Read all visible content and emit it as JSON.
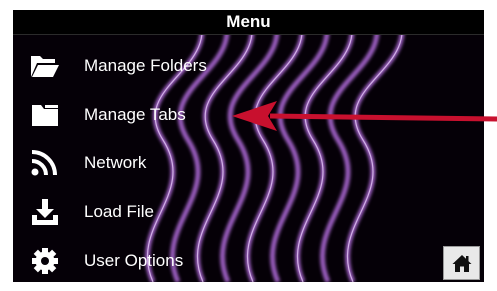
{
  "header": {
    "title": "Menu"
  },
  "menu": {
    "items": [
      {
        "label": "Manage Folders",
        "icon": "folder-open-icon"
      },
      {
        "label": "Manage Tabs",
        "icon": "folder-tab-icon"
      },
      {
        "label": "Network",
        "icon": "wifi-rss-icon"
      },
      {
        "label": "Load File",
        "icon": "download-icon"
      },
      {
        "label": "User Options",
        "icon": "gear-icon"
      }
    ]
  },
  "home_button": {
    "icon": "home-icon"
  },
  "colors": {
    "background": "#050007",
    "wave": "#b56ee0",
    "text": "#ffffff",
    "annotation_arrow": "#c8102e",
    "home_button_bg": "#e9e9e9"
  }
}
